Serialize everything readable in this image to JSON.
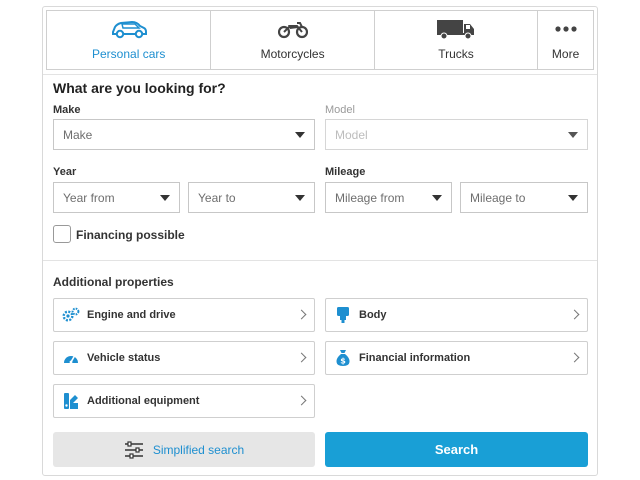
{
  "tabs": [
    {
      "label": "Personal cars",
      "icon": "car-icon",
      "active": true
    },
    {
      "label": "Motorcycles",
      "icon": "motorcycle-icon",
      "active": false
    },
    {
      "label": "Trucks",
      "icon": "truck-icon",
      "active": false
    },
    {
      "label": "More",
      "icon": "more-dots-icon",
      "active": false
    }
  ],
  "form": {
    "heading": "What are you looking for?",
    "make": {
      "label": "Make",
      "value": "Make"
    },
    "model": {
      "label": "Model",
      "value": "Model",
      "disabled": true
    },
    "year": {
      "label": "Year",
      "from": "Year from",
      "to": "Year to"
    },
    "mileage": {
      "label": "Mileage",
      "from": "Mileage from",
      "to": "Mileage to"
    },
    "financing": {
      "label": "Financing possible",
      "checked": false
    }
  },
  "additional": {
    "heading": "Additional properties",
    "items": [
      {
        "label": "Engine and drive",
        "icon": "gears-icon"
      },
      {
        "label": "Body",
        "icon": "car-body-icon"
      },
      {
        "label": "Vehicle status",
        "icon": "speedometer-icon"
      },
      {
        "label": "Financial information",
        "icon": "money-bag-icon"
      },
      {
        "label": "Additional equipment",
        "icon": "equipment-icon"
      }
    ]
  },
  "buttons": {
    "simplified": "Simplified search",
    "search": "Search"
  },
  "colors": {
    "accent": "#1e8fd0",
    "primary_button": "#199fd6",
    "secondary_button": "#e6e6e6"
  }
}
